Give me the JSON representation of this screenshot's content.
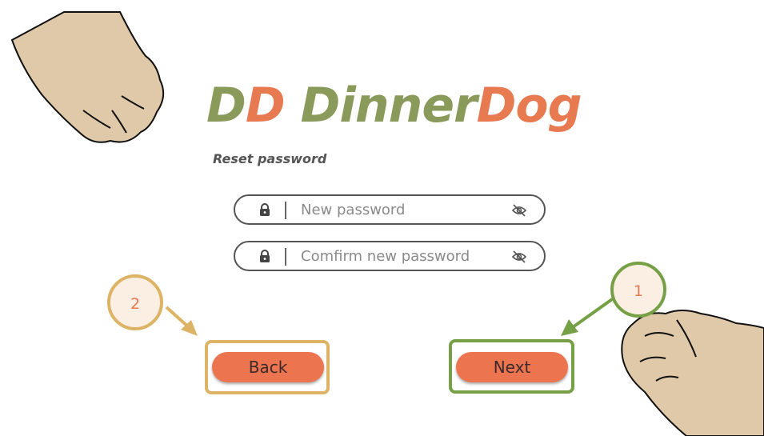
{
  "logo": {
    "part1": "D",
    "part2": "D",
    "part3": "Dinner",
    "part4": "Dog"
  },
  "subtitle": "Reset password",
  "fields": [
    {
      "placeholder": "New password",
      "lock_icon": "lock-icon",
      "eye_icon": "eye-slash-icon"
    },
    {
      "placeholder": "Comfirm new password",
      "lock_icon": "lock-icon",
      "eye_icon": "eye-slash-icon"
    }
  ],
  "buttons": {
    "back": "Back",
    "next": "Next"
  },
  "callouts": {
    "back_step": "2",
    "next_step": "1"
  },
  "colors": {
    "brand_green": "#8a9a5b",
    "brand_orange": "#e87a52",
    "button": "#ec7550",
    "frame_gold": "#ddb466",
    "frame_green": "#76a046",
    "paw": "#dfc9a8"
  }
}
